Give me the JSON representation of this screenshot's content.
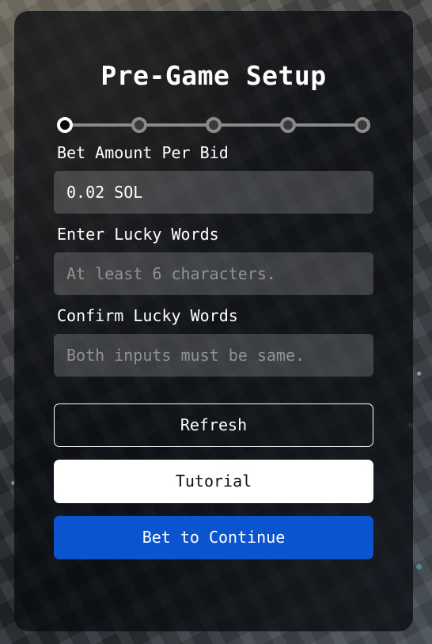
{
  "card": {
    "title": "Pre-Game Setup"
  },
  "stepper": {
    "total_steps": 5,
    "current_step": 1
  },
  "form": {
    "bet_amount": {
      "label": "Bet Amount Per Bid",
      "value": "0.02 SOL",
      "placeholder": ""
    },
    "lucky_words": {
      "label": "Enter Lucky Words",
      "value": "",
      "placeholder": "At least 6 characters."
    },
    "confirm_lucky_words": {
      "label": "Confirm Lucky Words",
      "value": "",
      "placeholder": "Both inputs must be same."
    }
  },
  "buttons": {
    "refresh": "Refresh",
    "tutorial": "Tutorial",
    "bet_to_continue": "Bet to Continue"
  },
  "colors": {
    "primary_button": "#0b54d0",
    "card_background": "rgba(6,8,12,0.72)",
    "active_step": "#ffffff",
    "inactive_step": "#8a8a8a"
  }
}
